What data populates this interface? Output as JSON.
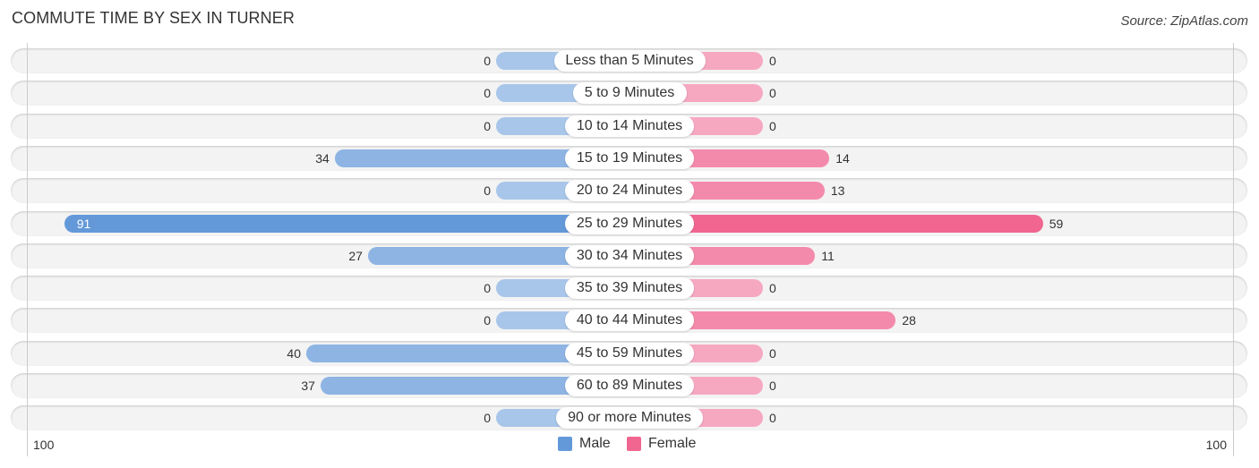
{
  "header": {
    "title": "COMMUTE TIME BY SEX IN TURNER",
    "source": "Source: ZipAtlas.com"
  },
  "colors": {
    "male_strong": "#6399d9",
    "male_light": "#a8c6ea",
    "male_mid": "#8db4e3",
    "female_strong": "#f06690",
    "female_light": "#f6a8c0",
    "female_mid": "#f48aab"
  },
  "chart_data": {
    "type": "bar",
    "orientation": "horizontal-diverging",
    "title": "COMMUTE TIME BY SEX IN TURNER",
    "categories": [
      "Less than 5 Minutes",
      "5 to 9 Minutes",
      "10 to 14 Minutes",
      "15 to 19 Minutes",
      "20 to 24 Minutes",
      "25 to 29 Minutes",
      "30 to 34 Minutes",
      "35 to 39 Minutes",
      "40 to 44 Minutes",
      "45 to 59 Minutes",
      "60 to 89 Minutes",
      "90 or more Minutes"
    ],
    "series": [
      {
        "name": "Male",
        "color": "#6399d9",
        "values": [
          0,
          0,
          0,
          34,
          0,
          91,
          27,
          0,
          0,
          40,
          37,
          0
        ]
      },
      {
        "name": "Female",
        "color": "#f06690",
        "values": [
          0,
          0,
          0,
          14,
          13,
          59,
          11,
          0,
          28,
          0,
          0,
          0
        ]
      }
    ],
    "axis": {
      "left_label": "100",
      "right_label": "100",
      "range": [
        0,
        100
      ]
    },
    "legend": {
      "position": "bottom-center",
      "items": [
        "Male",
        "Female"
      ]
    },
    "grid": false
  }
}
